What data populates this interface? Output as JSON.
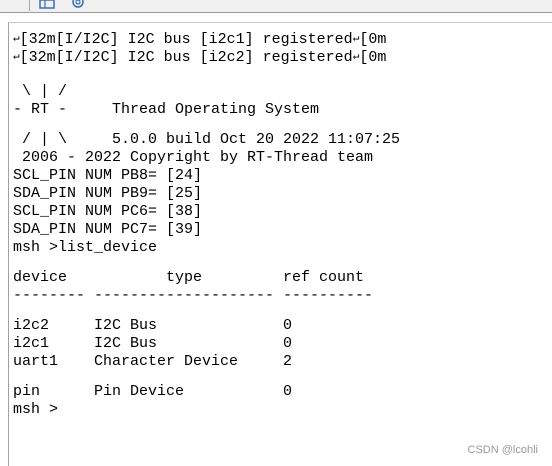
{
  "toolbar": {
    "buttons": [
      {
        "name": "window-icon"
      },
      {
        "name": "settings-icon"
      }
    ]
  },
  "terminal": {
    "escape_glyph": "↵",
    "lines": {
      "l1_rest": "[32m[I/I2C] I2C bus [i2c1] registered",
      "l1_tail": "[0m",
      "l2_rest": "[32m[I/I2C] I2C bus [i2c2] registered",
      "l2_tail": "[0m",
      "logo1": " \\ | /",
      "logo2": "- RT -     Thread Operating System",
      "logo3": " / | \\     5.0.0 build Oct 20 2022 11:07:25",
      "copyright": " 2006 - 2022 Copyright by RT-Thread team",
      "pin1": "SCL_PIN NUM PB8= [24]",
      "pin2": "SDA_PIN NUM PB9= [25]",
      "pin3": "SCL_PIN NUM PC6= [38]",
      "pin4": "SDA_PIN NUM PC7= [39]",
      "cmd": "msh >list_device",
      "header": "device           type         ref count",
      "divider": "-------- -------------------- ----------",
      "row1": "i2c2     I2C Bus              0",
      "row2": "i2c1     I2C Bus              0",
      "row3": "uart1    Character Device     2",
      "row4": "pin      Pin Device           0",
      "prompt": "msh >"
    }
  },
  "watermark": "CSDN @lcohli"
}
